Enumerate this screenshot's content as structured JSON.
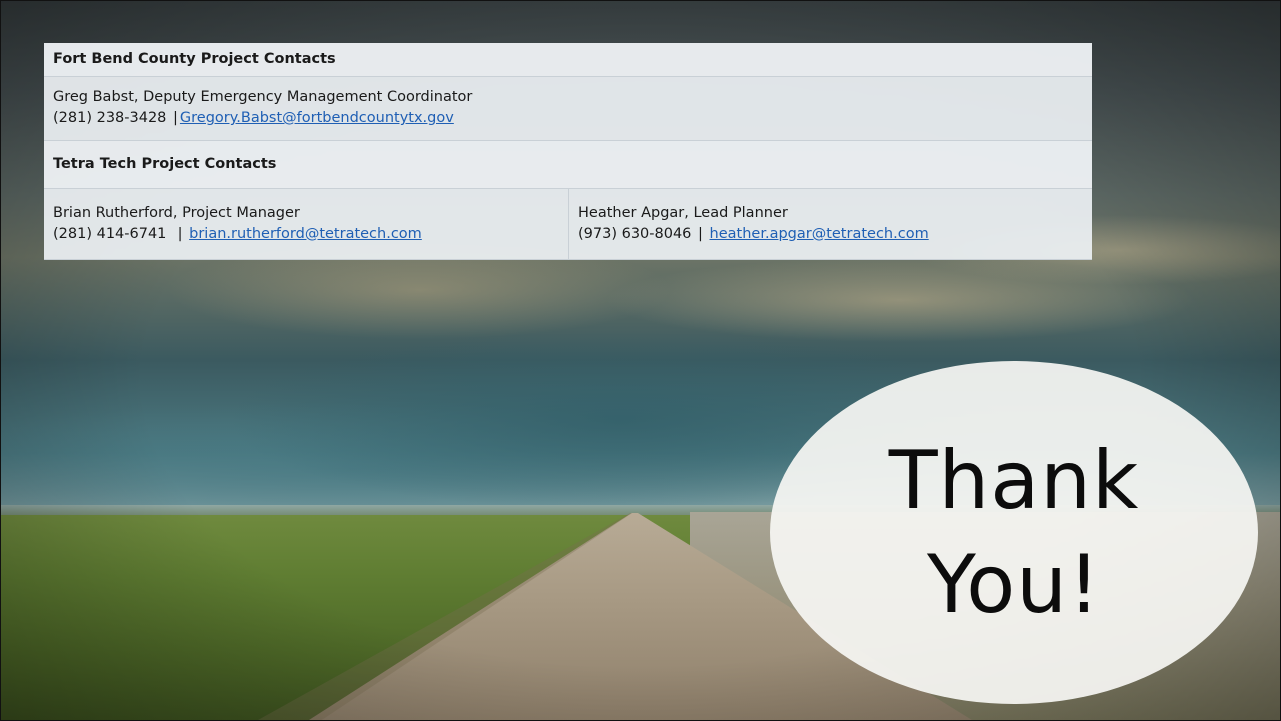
{
  "fort_bend": {
    "header": "Fort Bend County Project Contacts",
    "contact": {
      "name_title": "Greg Babst, Deputy Emergency Management Coordinator",
      "phone": "(281) 238-3428",
      "separator": "|",
      "email": "Gregory.Babst@fortbendcountytx.gov"
    }
  },
  "tetra_tech": {
    "header": "Tetra Tech Project Contacts",
    "contacts": [
      {
        "name_title": "Brian Rutherford, Project Manager",
        "phone": "(281) 414-6741",
        "separator": "|",
        "email": "brian.rutherford@tetratech.com"
      },
      {
        "name_title": "Heather Apgar, Lead Planner",
        "phone": "(973) 630-8046",
        "separator": "|",
        "email": "heather.apgar@tetratech.com"
      }
    ]
  },
  "closing": {
    "line1": "Thank",
    "line2": "You!"
  },
  "colors": {
    "link": "#1f5fb4",
    "table_bg": "#ecf0f3",
    "bubble_bg": "#f6f6f3"
  }
}
